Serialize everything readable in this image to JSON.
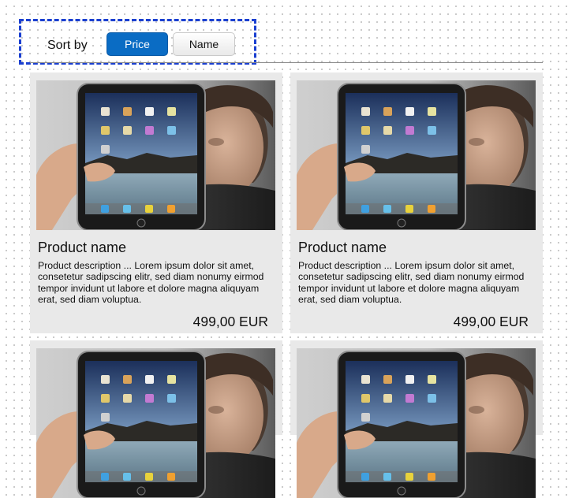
{
  "sort": {
    "label": "Sort by",
    "options": [
      "Price",
      "Name"
    ],
    "active": "Price"
  },
  "products": [
    {
      "name": "Product name",
      "description": "Product description   ... Lorem ipsum dolor sit amet, consetetur sadipscing elitr, sed diam nonumy eirmod tempor invidunt ut labore et dolore magna aliquyam erat, sed diam voluptua.",
      "price": "499,00 EUR"
    },
    {
      "name": "Product name",
      "description": "Product description   ... Lorem ipsum dolor sit amet, consetetur sadipscing elitr, sed diam nonumy eirmod tempor invidunt ut labore et dolore magna aliquyam erat, sed diam voluptua.",
      "price": "499,00 EUR"
    },
    {
      "name": "",
      "description": "",
      "price": ""
    },
    {
      "name": "",
      "description": "",
      "price": ""
    }
  ],
  "colors": {
    "accent": "#0a6cc4",
    "selection_border": "#1a3fd0",
    "card_background": "#e9e9e9"
  },
  "icons": [
    "tablet-product-image"
  ]
}
